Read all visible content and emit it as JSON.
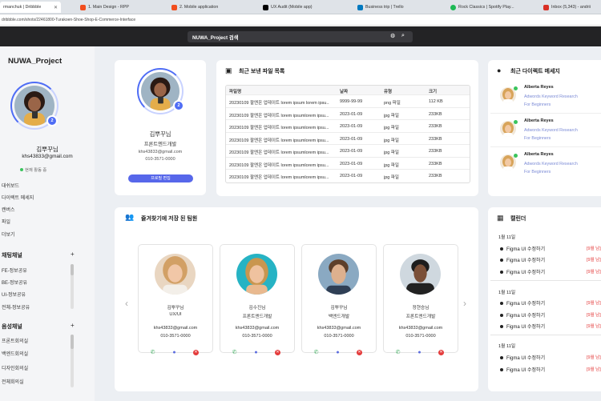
{
  "browser": {
    "tabs": [
      {
        "label": "rmanchuk | Dribbble",
        "icon": "dribbble-icon",
        "color": "#ea4c89"
      },
      {
        "label": "1. Main Design - RPP",
        "icon": "figma-icon",
        "color": "#f24e1e"
      },
      {
        "label": "2. Mobile application",
        "icon": "figma-icon",
        "color": "#f24e1e"
      },
      {
        "label": "UX Audit (Mobile app)",
        "icon": "notion-icon",
        "color": "#000000"
      },
      {
        "label": "Business trip | Trello",
        "icon": "trello-icon",
        "color": "#0079bf"
      },
      {
        "label": "Rock Classics | Spotify Play...",
        "icon": "spotify-icon",
        "color": "#1db954"
      },
      {
        "label": "Inbox (5,343) - andrii",
        "icon": "gmail-icon",
        "color": "#d93025"
      }
    ],
    "url": "dribbble.com/shots/22461800-Turakoen-Shoe-Shop-E-Commerce-Interface"
  },
  "search": {
    "value": "NUWA_Project 검색",
    "icons": [
      "filter-icon",
      "search-icon"
    ]
  },
  "sidebar": {
    "brand": "NUWA_Project",
    "badge": "2",
    "name": "김뿌꾸님",
    "email": "khs43833@gmail.com",
    "status": "현재 활동 중",
    "nav": [
      "대쉬보드",
      "다이렉트 메세지",
      "캔버스",
      "파일",
      "더보기"
    ],
    "chat_section": "채팅채널",
    "chat_channels": [
      "FE-정보공유",
      "BE-정보공유",
      "UI-정보공유",
      "전체-정보공유"
    ],
    "voice_section": "음성채널",
    "voice_channels": [
      "프론트회의실",
      "백엔드회의실",
      "디자인회의실",
      "전체회의실"
    ],
    "plus": "+"
  },
  "profile": {
    "badge": "2",
    "name": "김뿌꾸님",
    "role": "프론트엔드개발",
    "email": "khs43833@gmail.com",
    "phone": "010-3571-0000",
    "edit_button": "프로필 편집"
  },
  "files": {
    "title": "최근 보낸 파일 목록",
    "headers": [
      "파일명",
      "날짜",
      "유형",
      "크기"
    ],
    "rows": [
      [
        "20230109 팔엔온 업데이트 lorem ipsum lorem ipsu...",
        "9999-99-99",
        "png 파일",
        "112 KB"
      ],
      [
        "20230109 팔엔온 업데이트 lorem ipsumlorem ipsu...",
        "2023-01-09",
        "jpg 파일",
        "233KB"
      ],
      [
        "20230109 팔엔온 업데이트 lorem ipsumlorem ipsu...",
        "2023-01-09",
        "jpg 파일",
        "233KB"
      ],
      [
        "20230109 팔엔온 업데이트 lorem ipsumlorem ipsu...",
        "2023-01-09",
        "jpg 파일",
        "233KB"
      ],
      [
        "20230109 팔엔온 업데이트 lorem ipsumlorem ipsu...",
        "2023-01-09",
        "jpg 파일",
        "233KB"
      ],
      [
        "20230109 팔엔온 업데이트 lorem ipsumlorem ipsu...",
        "2023-01-09",
        "jpg 파일",
        "233KB"
      ],
      [
        "20230109 팔엔온 업데이트 lorem ipsumlorem ipsu...",
        "2023-01-09",
        "jpg 파일",
        "233KB"
      ]
    ]
  },
  "messages": {
    "title": "최근 다이렉트 메세지",
    "items": [
      {
        "name": "Alberta Reyes",
        "line1": "Adwords Keyword Research",
        "line2": "For Beginners"
      },
      {
        "name": "Alberta Reyes",
        "line1": "Adwords Keyword Research",
        "line2": "For Beginners"
      },
      {
        "name": "Alberta Reyes",
        "line1": "Adwords Keyword Research",
        "line2": "For Beginners"
      }
    ]
  },
  "favorites": {
    "title": "즐겨찾기에 저장 된 팀원",
    "prev": "‹",
    "next": "›",
    "cards": [
      {
        "name": "김뿌꾸님",
        "role": "UX/UI",
        "email": "khs43833@gmail.com",
        "phone": "010-3571-0000"
      },
      {
        "name": "김수진님",
        "role": "프론트엔드개발",
        "email": "khs43833@gmail.com",
        "phone": "010-3571-0000"
      },
      {
        "name": "김뿌꾸님",
        "role": "백엔드개발",
        "email": "khs43833@gmail.com",
        "phone": "010-3571-0000"
      },
      {
        "name": "정현승님",
        "role": "프론트엔드개발",
        "email": "khs43833@gmail.com",
        "phone": "010-3571-0000"
      }
    ]
  },
  "calendar": {
    "title": "캘린더",
    "groups": [
      {
        "date": "1월 11일",
        "items": [
          {
            "text": "Figma UI 수정하기",
            "time": "[9월 남]"
          },
          {
            "text": "Figma UI 수정하기",
            "time": "[9월 남]"
          },
          {
            "text": "Figma UI 수정하기",
            "time": "[9월 남]"
          }
        ]
      },
      {
        "date": "1월 11일",
        "items": [
          {
            "text": "Figma UI 수정하기",
            "time": "[9월 남]"
          },
          {
            "text": "Figma UI 수정하기",
            "time": "[9월 남]"
          },
          {
            "text": "Figma UI 수정하기",
            "time": "[9월 남]"
          }
        ]
      },
      {
        "date": "1월 11일",
        "items": [
          {
            "text": "Figma UI 수정하기",
            "time": "[9월 남]"
          },
          {
            "text": "Figma UI 수정하기",
            "time": "[9월 남]"
          }
        ]
      }
    ]
  },
  "colors": {
    "accent": "#4f6df5",
    "online": "#3ac45d",
    "danger": "#e43b3b",
    "topbar": "#232325"
  }
}
